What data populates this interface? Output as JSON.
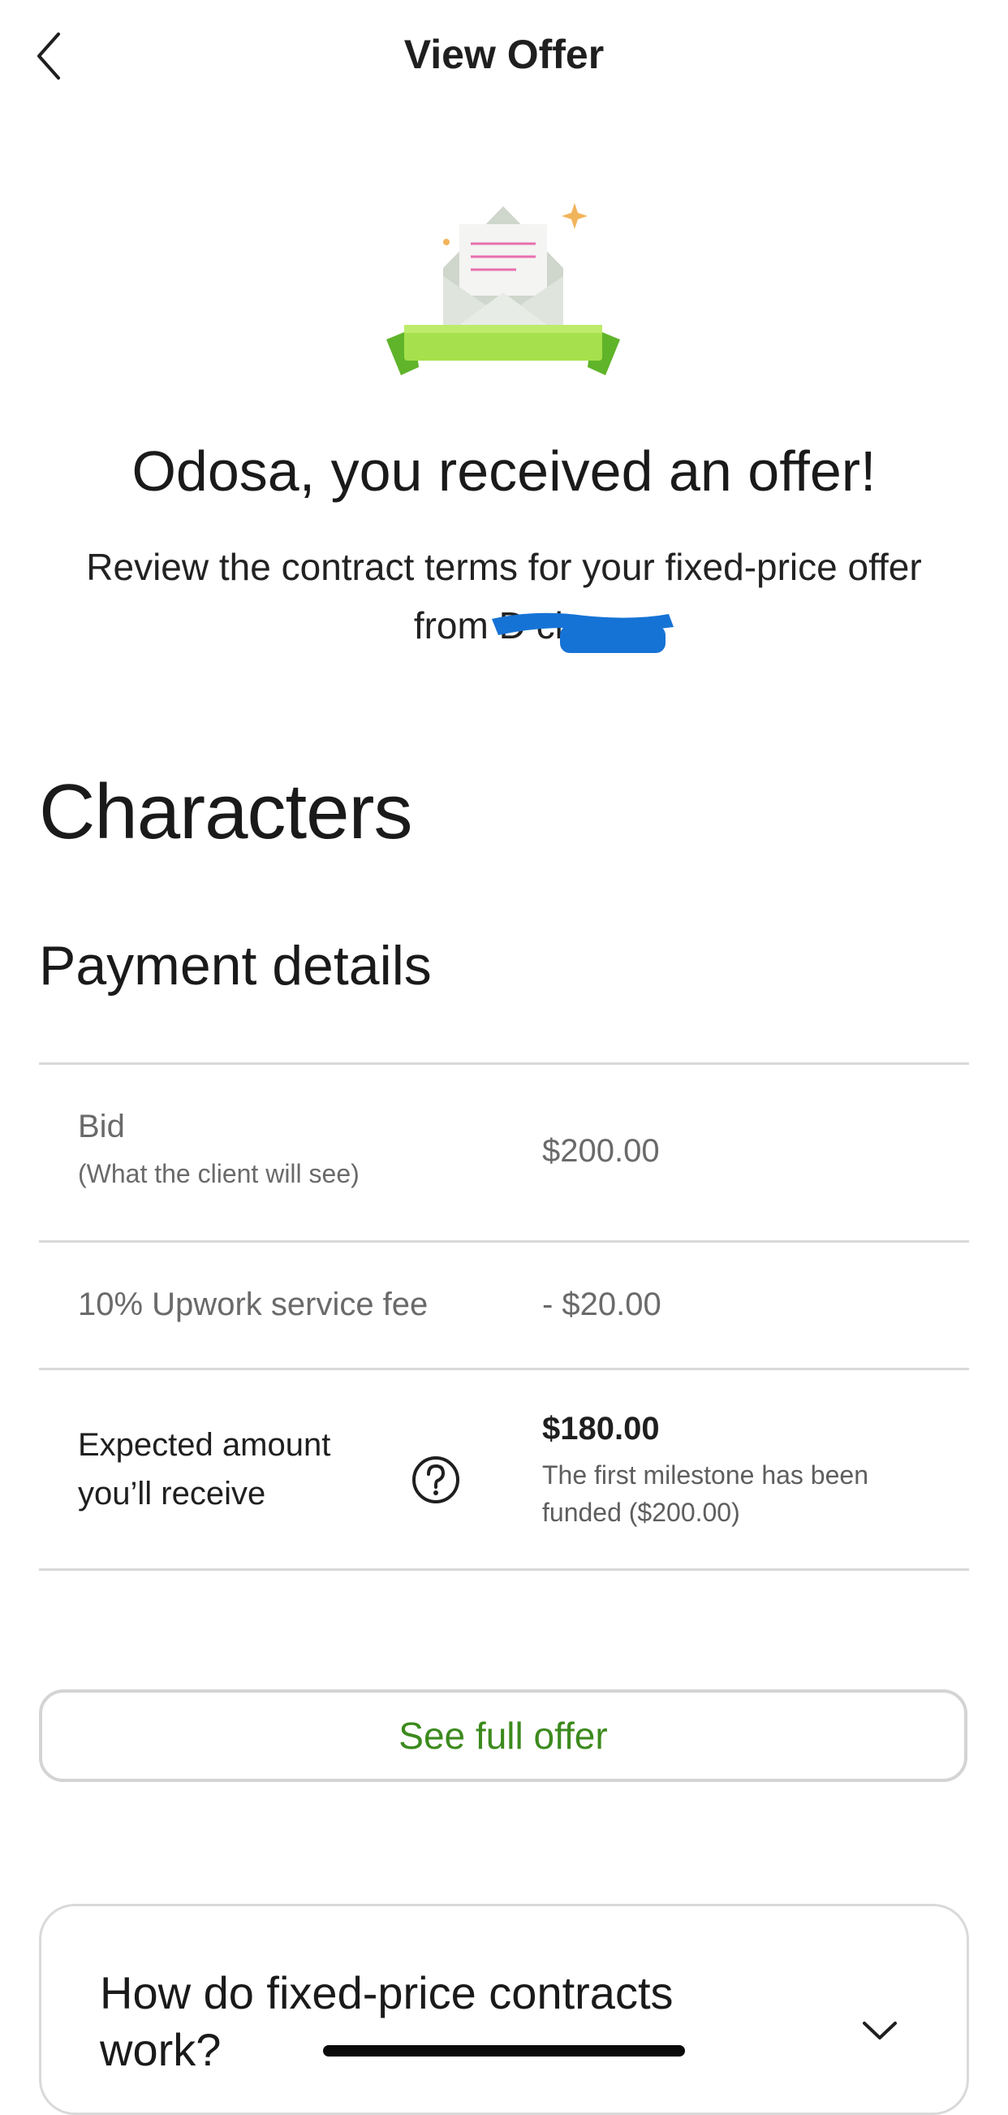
{
  "header": {
    "title": "View Offer",
    "back_icon": "chevron-left-icon"
  },
  "hero": {
    "illustration_icon": "envelope-offer-icon",
    "title": "Odosa, you received an offer!",
    "subtitle": "Review the contract terms for your fixed-price offer from D           cia."
  },
  "job": {
    "title": "Characters"
  },
  "payment": {
    "section_title": "Payment details",
    "bid": {
      "label": "Bid",
      "sublabel": "(What the client will see)",
      "value": "$200.00"
    },
    "fee": {
      "label": "10% Upwork service fee",
      "value": "- $20.00"
    },
    "expected": {
      "label": "Expected amount you’ll receive",
      "value": "$180.00",
      "note": "The first milestone has been funded ($200.00)",
      "help_icon": "question-circle-icon"
    }
  },
  "actions": {
    "see_full_offer": "See full offer"
  },
  "faq": {
    "title": "How do fixed-price contracts work?",
    "expand_icon": "chevron-down-icon"
  },
  "colors": {
    "accent_green": "#3c8a1e",
    "ribbon_green": "#8fd43a",
    "redaction_blue": "#1673d6"
  }
}
